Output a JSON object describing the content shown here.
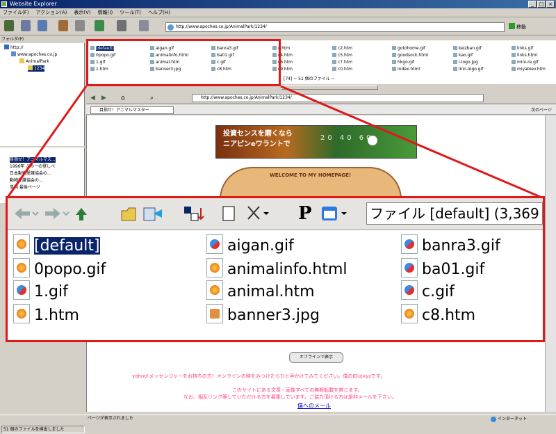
{
  "window": {
    "title": "Website Explorer"
  },
  "menu": [
    "ファイル(F)",
    "アクション(A)",
    "表示(V)",
    "情報(I)",
    "ツール(T)",
    "ヘルプ(H)"
  ],
  "address": {
    "url": "http://www.apoches.co.jp/AnimalPark/1234/"
  },
  "go": {
    "label": "移動"
  },
  "folder_pane": {
    "header": "フォルダ(F)",
    "nodes": [
      "http://",
      "www.apoches.co.jp",
      "AnimalPark",
      "1234"
    ]
  },
  "small_files": [
    [
      "[default]",
      "aigan.gif",
      "banra3.gif",
      "c.htm",
      "c2.htm",
      "gotohome.gif",
      "keizban.gif",
      "links.gif"
    ],
    [
      "0popo.gif",
      "animalinfo.html",
      "ba01.gif",
      "c4.htm",
      "c5.htm",
      "goodsock.html",
      "kao.gif",
      "links.html"
    ],
    [
      "1.gif",
      "animal.htm",
      "c.gif",
      "c6.htm",
      "c7.htm",
      "hkgo.gif",
      "l-logo.jpg",
      "mini-re.gif"
    ],
    [
      "1.htm",
      "banner3.jpg",
      "c8.htm",
      "c9.htm",
      "c0.htm",
      "index.html",
      "linn-logo.gif",
      "miyabiev.htm"
    ]
  ],
  "small_info": "[74]  ~ 51 個のファイル ~",
  "browser": {
    "url": "http://www.apoches.co.jp/AnimalPark/1234/",
    "tab": "目指せ！アニマルマスター",
    "next": "次のページ"
  },
  "banner": {
    "line1": "投資センスを磨くなら",
    "line2": "ニアピンeワラントで",
    "nums": "20 40 60"
  },
  "welcome": "WELCOME TO MY HOMEPAGE!",
  "bookmarks": [
    "目指せ！アニマルマス...",
    "1996年 ぶみーの登しべ",
    "日本動物愛護協会の...",
    "動物愛護協会の...",
    "単純 最後ページ"
  ],
  "zoom": {
    "info": "ファイル [default] (3,369",
    "files": [
      {
        "name": "[default]",
        "type": "html",
        "selected": true
      },
      {
        "name": "aigan.gif",
        "type": "gif"
      },
      {
        "name": "banra3.gif",
        "type": "gif"
      },
      {
        "name": "0popo.gif",
        "type": "html"
      },
      {
        "name": "animalinfo.html",
        "type": "html"
      },
      {
        "name": "ba01.gif",
        "type": "gif"
      },
      {
        "name": "1.gif",
        "type": "gif"
      },
      {
        "name": "animal.htm",
        "type": "html"
      },
      {
        "name": "c.gif",
        "type": "gif"
      },
      {
        "name": "1.htm",
        "type": "html"
      },
      {
        "name": "banner3.jpg",
        "type": "jpg"
      },
      {
        "name": "c8.htm",
        "type": "html"
      }
    ]
  },
  "page_button": "オフラインで表示",
  "pink_text": [
    "yahoo!メッセンジャーをお持ちの方！オンラインの時をみつけたらひと声かけてみてください。僕のIDはxyzです。",
    "このサイトにある文章・画像すべての無断転載を禁じます。",
    "なお、相互リンク等していただける方を募集しています。ご協力頂ける方は是非メールを下さい。"
  ],
  "mail_link": "僕へのメール",
  "status": {
    "left": "51 個のファイルを検出しました",
    "middle": "ページが表示されました",
    "zone": "インターネット"
  }
}
